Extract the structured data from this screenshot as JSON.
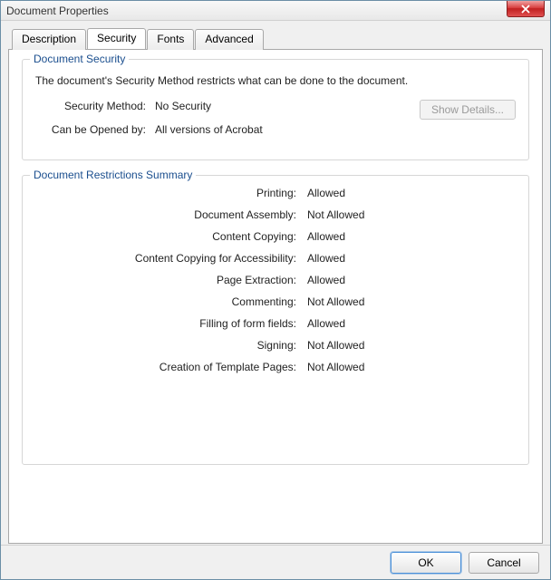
{
  "window": {
    "title": "Document Properties"
  },
  "tabs": {
    "description": "Description",
    "security": "Security",
    "fonts": "Fonts",
    "advanced": "Advanced"
  },
  "security_group": {
    "title": "Document Security",
    "description": "The document's Security Method restricts what can be done to the document.",
    "method_label": "Security Method:",
    "method_value": "No Security",
    "opened_label": "Can be Opened by:",
    "opened_value": "All versions of Acrobat",
    "show_details": "Show Details..."
  },
  "restrictions_group": {
    "title": "Document Restrictions Summary",
    "items": [
      {
        "label": "Printing:",
        "value": "Allowed"
      },
      {
        "label": "Document Assembly:",
        "value": "Not Allowed"
      },
      {
        "label": "Content Copying:",
        "value": "Allowed"
      },
      {
        "label": "Content Copying for Accessibility:",
        "value": "Allowed"
      },
      {
        "label": "Page Extraction:",
        "value": "Allowed"
      },
      {
        "label": "Commenting:",
        "value": "Not Allowed"
      },
      {
        "label": "Filling of form fields:",
        "value": "Allowed"
      },
      {
        "label": "Signing:",
        "value": "Not Allowed"
      },
      {
        "label": "Creation of Template Pages:",
        "value": "Not Allowed"
      }
    ]
  },
  "footer": {
    "ok": "OK",
    "cancel": "Cancel"
  }
}
